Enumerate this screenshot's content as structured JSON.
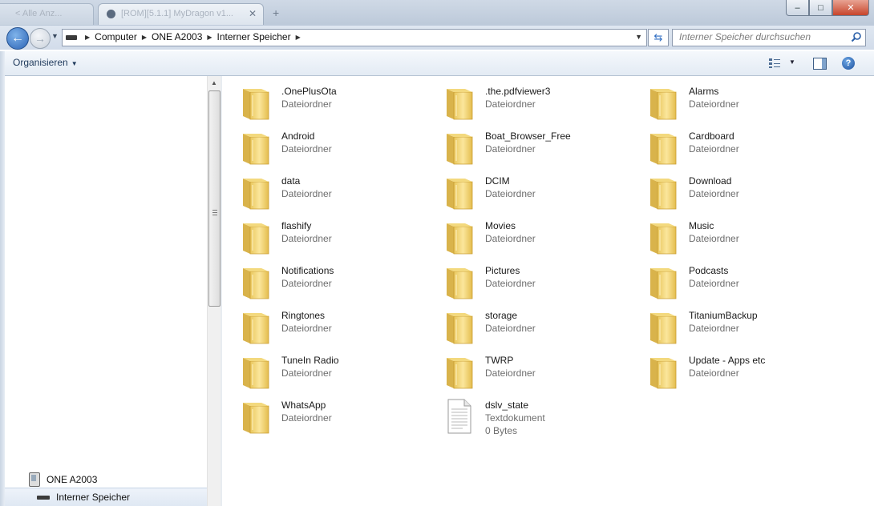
{
  "window": {
    "tab_inactive_label": "< Alle Anz...",
    "tab_active_label": "[ROM][5.1.1] MyDragon v1...",
    "minimize": "–",
    "maximize": "□",
    "close": "✕"
  },
  "address_bar": {
    "breadcrumbs": [
      "Computer",
      "ONE A2003",
      "Interner Speicher"
    ],
    "search_placeholder": "Interner Speicher durchsuchen"
  },
  "toolbar": {
    "organize_label": "Organisieren",
    "help_label": "?"
  },
  "nav_pane": {
    "device_label": "ONE A2003",
    "storage_label": "Interner Speicher"
  },
  "items": [
    {
      "name": ".OnePlusOta",
      "type": "Dateiordner",
      "kind": "folder"
    },
    {
      "name": ".the.pdfviewer3",
      "type": "Dateiordner",
      "kind": "folder"
    },
    {
      "name": "Alarms",
      "type": "Dateiordner",
      "kind": "folder"
    },
    {
      "name": "Android",
      "type": "Dateiordner",
      "kind": "folder"
    },
    {
      "name": "Boat_Browser_Free",
      "type": "Dateiordner",
      "kind": "folder"
    },
    {
      "name": "Cardboard",
      "type": "Dateiordner",
      "kind": "folder"
    },
    {
      "name": "data",
      "type": "Dateiordner",
      "kind": "folder"
    },
    {
      "name": "DCIM",
      "type": "Dateiordner",
      "kind": "folder"
    },
    {
      "name": "Download",
      "type": "Dateiordner",
      "kind": "folder"
    },
    {
      "name": "flashify",
      "type": "Dateiordner",
      "kind": "folder"
    },
    {
      "name": "Movies",
      "type": "Dateiordner",
      "kind": "folder"
    },
    {
      "name": "Music",
      "type": "Dateiordner",
      "kind": "folder"
    },
    {
      "name": "Notifications",
      "type": "Dateiordner",
      "kind": "folder"
    },
    {
      "name": "Pictures",
      "type": "Dateiordner",
      "kind": "folder"
    },
    {
      "name": "Podcasts",
      "type": "Dateiordner",
      "kind": "folder"
    },
    {
      "name": "Ringtones",
      "type": "Dateiordner",
      "kind": "folder"
    },
    {
      "name": "storage",
      "type": "Dateiordner",
      "kind": "folder"
    },
    {
      "name": "TitaniumBackup",
      "type": "Dateiordner",
      "kind": "folder"
    },
    {
      "name": "TuneIn Radio",
      "type": "Dateiordner",
      "kind": "folder"
    },
    {
      "name": "TWRP",
      "type": "Dateiordner",
      "kind": "folder"
    },
    {
      "name": "Update - Apps etc",
      "type": "Dateiordner",
      "kind": "folder"
    },
    {
      "name": "WhatsApp",
      "type": "Dateiordner",
      "kind": "folder"
    },
    {
      "name": "dslv_state",
      "type": "Textdokument",
      "size": "0 Bytes",
      "kind": "text-file"
    }
  ],
  "colors": {
    "folder": "#f2d473",
    "accent": "#2c64b6",
    "secondary_text": "#6d6d6d"
  }
}
